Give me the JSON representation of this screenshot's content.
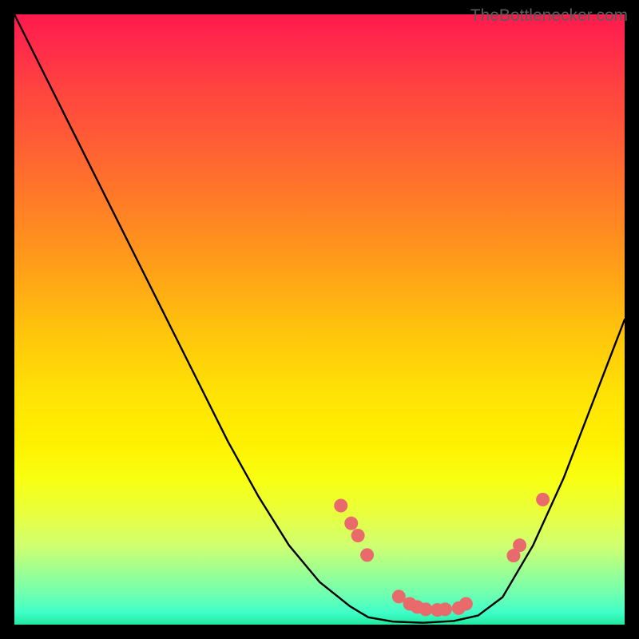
{
  "watermark_text": "TheBottlenecker.com",
  "chart_data": {
    "type": "line",
    "title": "",
    "xlabel": "",
    "ylabel": "",
    "xlim": [
      0,
      100
    ],
    "ylim": [
      0,
      100
    ],
    "curve": [
      {
        "x": 0,
        "y": 100
      },
      {
        "x": 5,
        "y": 90
      },
      {
        "x": 10,
        "y": 80
      },
      {
        "x": 15,
        "y": 70
      },
      {
        "x": 20,
        "y": 60
      },
      {
        "x": 25,
        "y": 50
      },
      {
        "x": 30,
        "y": 40
      },
      {
        "x": 35,
        "y": 30
      },
      {
        "x": 40,
        "y": 21
      },
      {
        "x": 45,
        "y": 13
      },
      {
        "x": 50,
        "y": 7
      },
      {
        "x": 55,
        "y": 3
      },
      {
        "x": 58,
        "y": 1.2
      },
      {
        "x": 62,
        "y": 0.5
      },
      {
        "x": 67,
        "y": 0.3
      },
      {
        "x": 72,
        "y": 0.6
      },
      {
        "x": 76,
        "y": 1.5
      },
      {
        "x": 80,
        "y": 4.5
      },
      {
        "x": 85,
        "y": 13
      },
      {
        "x": 90,
        "y": 24
      },
      {
        "x": 95,
        "y": 37
      },
      {
        "x": 100,
        "y": 50
      }
    ],
    "points": [
      {
        "x": 53.5,
        "y": 19.5
      },
      {
        "x": 55.2,
        "y": 16.6
      },
      {
        "x": 56.3,
        "y": 14.6
      },
      {
        "x": 57.8,
        "y": 11.4
      },
      {
        "x": 63.0,
        "y": 4.6
      },
      {
        "x": 64.8,
        "y": 3.4
      },
      {
        "x": 66.0,
        "y": 2.9
      },
      {
        "x": 67.4,
        "y": 2.5
      },
      {
        "x": 69.3,
        "y": 2.4
      },
      {
        "x": 70.6,
        "y": 2.5
      },
      {
        "x": 72.8,
        "y": 2.7
      },
      {
        "x": 74.0,
        "y": 3.4
      },
      {
        "x": 81.8,
        "y": 11.3
      },
      {
        "x": 82.8,
        "y": 13.0
      },
      {
        "x": 86.6,
        "y": 20.5
      }
    ]
  }
}
